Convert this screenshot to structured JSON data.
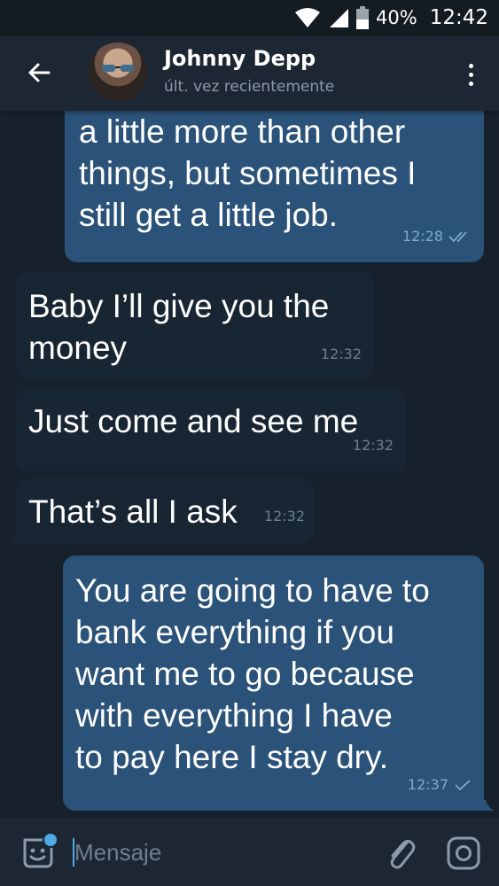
{
  "status_bar": {
    "battery": "40%",
    "time": "12:42",
    "icons": [
      "wifi-icon",
      "signal-icon",
      "battery-icon"
    ]
  },
  "header": {
    "contact_name": "Johnny Depp",
    "status": "últ. vez recientemente",
    "icons": [
      "back-arrow-icon",
      "more-vert-icon"
    ]
  },
  "messages": [
    {
      "direction": "outgoing",
      "text": "only covers the rent and\na little more than other\nthings, but sometimes I\nstill get a little job.",
      "time": "12:28",
      "read": true
    },
    {
      "direction": "incoming",
      "text": "Baby I’ll give you the\nmoney",
      "time": "12:32"
    },
    {
      "direction": "incoming",
      "text": "Just come and see me",
      "time": "12:32"
    },
    {
      "direction": "incoming",
      "text": "That’s all I ask",
      "time": "12:32"
    },
    {
      "direction": "outgoing",
      "text": "You are going to have to\nbank everything if you\nwant me to go because\nwith everything I have\nto pay here I stay dry.",
      "time": "12:37",
      "read": false
    }
  ],
  "input": {
    "placeholder": "Mensaje",
    "value": ""
  },
  "colors": {
    "background": "#17212b",
    "header": "#1d2733",
    "outgoing_bubble": "#2b5278",
    "incoming_bubble": "#182533",
    "accent": "#4fa9e6",
    "secondary_text": "#8b9bab"
  }
}
